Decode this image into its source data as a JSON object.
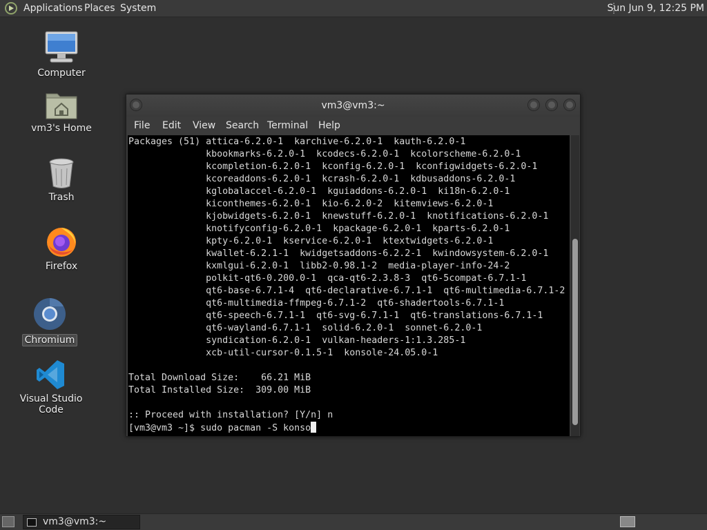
{
  "top_panel": {
    "menus": [
      "Applications",
      "Places",
      "System"
    ],
    "clock": "Sun Jun  9, 12:25 PM"
  },
  "desktop": {
    "icons": [
      {
        "label": "Computer",
        "icon": "computer-icon"
      },
      {
        "label": "vm3's Home",
        "icon": "home-folder-icon"
      },
      {
        "label": "Trash",
        "icon": "trash-icon"
      },
      {
        "label": "Firefox",
        "icon": "firefox-icon"
      },
      {
        "label": "Chromium",
        "icon": "chromium-icon",
        "selected": true
      },
      {
        "label": "Visual Studio Code",
        "icon": "vscode-icon"
      }
    ]
  },
  "terminal": {
    "title": "vm3@vm3:~",
    "menu": [
      "File",
      "Edit",
      "View",
      "Search",
      "Terminal",
      "Help"
    ],
    "lines": [
      "Packages (51) attica-6.2.0-1  karchive-6.2.0-1  kauth-6.2.0-1",
      "              kbookmarks-6.2.0-1  kcodecs-6.2.0-1  kcolorscheme-6.2.0-1",
      "              kcompletion-6.2.0-1  kconfig-6.2.0-1  kconfigwidgets-6.2.0-1",
      "              kcoreaddons-6.2.0-1  kcrash-6.2.0-1  kdbusaddons-6.2.0-1",
      "              kglobalaccel-6.2.0-1  kguiaddons-6.2.0-1  ki18n-6.2.0-1",
      "              kiconthemes-6.2.0-1  kio-6.2.0-2  kitemviews-6.2.0-1",
      "              kjobwidgets-6.2.0-1  knewstuff-6.2.0-1  knotifications-6.2.0-1",
      "              knotifyconfig-6.2.0-1  kpackage-6.2.0-1  kparts-6.2.0-1",
      "              kpty-6.2.0-1  kservice-6.2.0-1  ktextwidgets-6.2.0-1",
      "              kwallet-6.2.1-1  kwidgetsaddons-6.2.2-1  kwindowsystem-6.2.0-1",
      "              kxmlgui-6.2.0-1  libb2-0.98.1-2  media-player-info-24-2",
      "              polkit-qt6-0.200.0-1  qca-qt6-2.3.8-3  qt6-5compat-6.7.1-1",
      "              qt6-base-6.7.1-4  qt6-declarative-6.7.1-1  qt6-multimedia-6.7.1-2",
      "              qt6-multimedia-ffmpeg-6.7.1-2  qt6-shadertools-6.7.1-1",
      "              qt6-speech-6.7.1-1  qt6-svg-6.7.1-1  qt6-translations-6.7.1-1",
      "              qt6-wayland-6.7.1-1  solid-6.2.0-1  sonnet-6.2.0-1",
      "              syndication-6.2.0-1  vulkan-headers-1:1.3.285-1",
      "              xcb-util-cursor-0.1.5-1  konsole-24.05.0-1",
      "",
      "Total Download Size:    66.21 MiB",
      "Total Installed Size:  309.00 MiB",
      "",
      ":: Proceed with installation? [Y/n] n"
    ],
    "prompt": "[vm3@vm3 ~]$ ",
    "input": "sudo pacman -S konso"
  },
  "taskbar": {
    "window_label": "vm3@vm3:~"
  },
  "colors": {
    "panel": "#3a3a3a",
    "desktop": "#2f2f2f",
    "terminal_bg": "#000000",
    "terminal_fg": "#d8d8d8"
  }
}
